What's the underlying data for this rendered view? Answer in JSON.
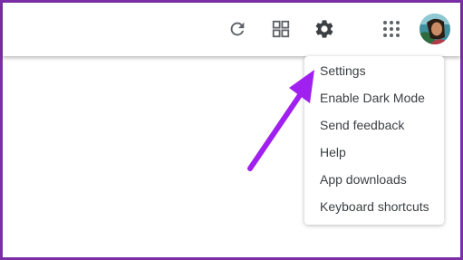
{
  "toolbar": {
    "icons": [
      "refresh-icon",
      "view-grid-icon",
      "gear-icon",
      "apps-grid-icon"
    ],
    "avatar": "user-avatar"
  },
  "settings_menu": {
    "items": [
      {
        "label": "Settings"
      },
      {
        "label": "Enable Dark Mode"
      },
      {
        "label": "Send feedback"
      },
      {
        "label": "Help"
      },
      {
        "label": "App downloads"
      },
      {
        "label": "Keyboard shortcuts"
      }
    ]
  },
  "annotation": {
    "arrow_color": "#a020f0",
    "frame_color": "#7b2fa6"
  }
}
